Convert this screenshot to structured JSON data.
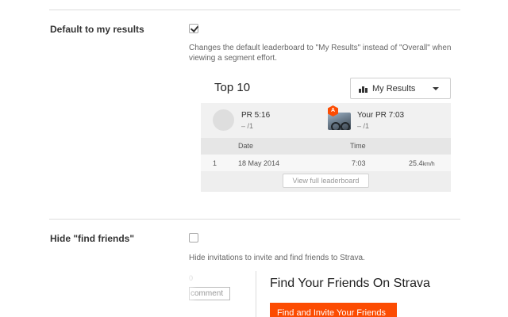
{
  "settings": {
    "default_results": {
      "title": "Default to my results",
      "checked": true,
      "description": "Changes the default leaderboard to \"My Results\" instead of \"Overall\" when viewing a segment effort."
    },
    "hide_find_friends": {
      "title": "Hide \"find friends\"",
      "checked": false,
      "description": "Hide invitations to invite and find friends to Strava."
    }
  },
  "leaderboard": {
    "title": "Top 10",
    "dropdown_label": "My Results",
    "pr": {
      "name": "PR 5:16",
      "sub": "– /1"
    },
    "your_pr": {
      "name": "Your PR 7:03",
      "sub": "– /1",
      "badge": "A"
    },
    "columns": {
      "date": "Date",
      "time": "Time"
    },
    "rows": [
      {
        "rank": "1",
        "date": "18 May 2014",
        "time": "7:03",
        "speed": "25.4",
        "speed_unit": "km/h"
      }
    ],
    "view_full_label": "View full leaderboard"
  },
  "find_friends": {
    "partial_number": "0",
    "comment_label": "comment",
    "title": "Find Your Friends On Strava",
    "button_label": "Find and Invite Your Friends"
  },
  "colors": {
    "brand_orange": "#fc4c02",
    "divider": "#dcdcdc"
  }
}
